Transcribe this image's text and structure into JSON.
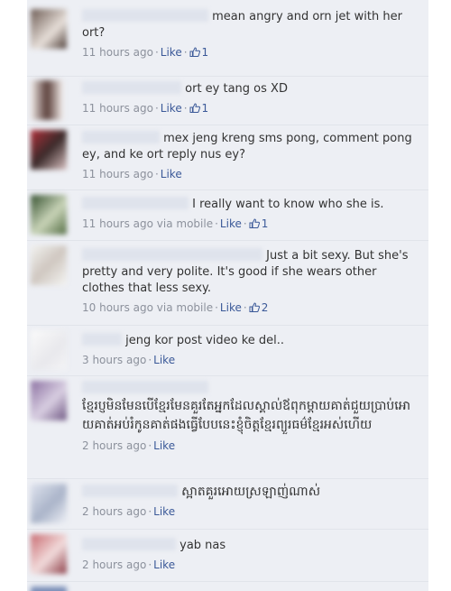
{
  "comments": [
    {
      "text": "mean angry and orn jet with her ort?",
      "time": "11 hours ago",
      "via": "",
      "like": "Like",
      "likes": "1"
    },
    {
      "text": "ort ey tang os XD",
      "time": "11 hours ago",
      "via": "",
      "like": "Like",
      "likes": "1"
    },
    {
      "text": "mex jeng kreng sms pong, comment pong ey, and ke ort reply nus ey?",
      "time": "11 hours ago",
      "via": "",
      "like": "Like",
      "likes": ""
    },
    {
      "text": "I really want to know who she is.",
      "time": "11 hours ago",
      "via": "via mobile",
      "like": "Like",
      "likes": "1"
    },
    {
      "text": "Just a bit sexy. But she's pretty and very polite. It's good if she wears other clothes that less sexy.",
      "time": "10 hours ago",
      "via": "via mobile",
      "like": "Like",
      "likes": "2"
    },
    {
      "text": "jeng kor post video ke del..",
      "time": "3 hours ago",
      "via": "",
      "like": "Like",
      "likes": ""
    },
    {
      "text": "ខ្មែរប្ញមិនមែនបើខ្មែរមែនគួរតែអ្នកដែលស្គាល់ឪពុកម្តាយគាត់ជួយប្រាប់អោយគាត់អប់រំកូនគាត់ផងធ្វើបែបនេះខ្ញុំចិត្តខ្មែរព្យួរធម៌ខ្មែរអស់ហើយ",
      "time": "2 hours ago",
      "via": "",
      "like": "Like",
      "likes": ""
    },
    {
      "text": "ស្អាតគួរអោយស្រឡាញ់ណាស់",
      "time": "2 hours ago",
      "via": "",
      "like": "Like",
      "likes": ""
    },
    {
      "text": "yab nas",
      "time": "2 hours ago",
      "via": "",
      "like": "Like",
      "likes": ""
    }
  ],
  "colors": {
    "link": "#3b5998",
    "meta": "#8c919c",
    "panel": "#edeff4"
  }
}
